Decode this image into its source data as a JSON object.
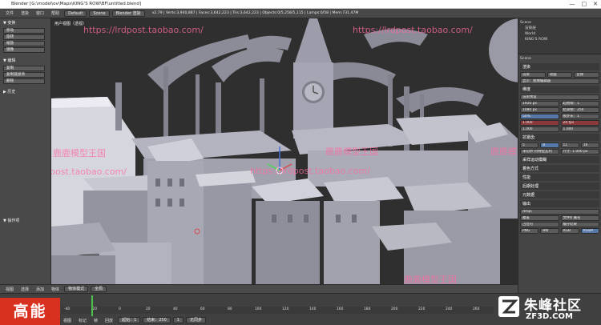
{
  "window": {
    "title": "Blender [G:\\model\\ov\\Maps\\KING'S ROW\\BF\\untitled.blend]",
    "controls": [
      "—",
      "□",
      "✕"
    ]
  },
  "infobar": {
    "menus": [
      "文件",
      "渲染",
      "窗口",
      "帮助"
    ],
    "layout": "Default",
    "scene": "Scene",
    "engine": "Blender 渲染",
    "stats": "v2.79 | Verts:3,940,887 | Faces:3,642,223 | Tris:3,642,223 | Objects:0/5,258/5,115 | Lamps:0/58 | Mem:731.47M"
  },
  "left_panel": {
    "transform_header": "▼ 变换",
    "transform_buttons": [
      "移动",
      "旋转",
      "缩放",
      "镜像"
    ],
    "edit_header": "▼ 编辑",
    "edit_buttons": [
      "复制",
      "复制链接项",
      "删除"
    ],
    "history_header": "▶ 历史",
    "operator_header": "▼ 操作项"
  },
  "viewport": {
    "header": "用户视图（透视）",
    "label": "(1) Collection | KING'S ROW"
  },
  "watermarks": [
    "https://lrdpost.taobao.com/",
    "https://lrdpost.taobao.com/",
    "https://lrdpost.taobao.com/",
    "鹿鹿模型王国",
    "鹿鹿模型王国",
    "鹿鹿模型王国",
    "鹿鹿模型王国",
    "post.taobao.com/"
  ],
  "view_footer": {
    "items": [
      "视图",
      "选择",
      "添加",
      "物体",
      "物体模式",
      "全局"
    ]
  },
  "outliner": {
    "items": [
      "Scene",
      "渲染层",
      "World",
      "KING'S ROW"
    ]
  },
  "properties": {
    "scene_label": "Scene",
    "sections": [
      "渲染",
      "维度",
      "抗锯齿",
      "采样运动模糊",
      "着色方式",
      "性能",
      "后期处理",
      "元数据",
      "输出"
    ],
    "render_buttons": [
      "渲染",
      "动画",
      "音频"
    ],
    "display": "显示：图像编辑器",
    "preset": "渲染预设",
    "resolution_x": "1920 px",
    "resolution_y": "1080 px",
    "resolution_pct": "50%",
    "frame_start": "起始帧：1",
    "frame_end": "结束帧：250",
    "frame_step": "帧步长：1",
    "aspect_x": "1.000",
    "aspect_y": "1.000",
    "fps": "24 fps",
    "time_stretch": "1.000",
    "aa_samples": [
      "5",
      "8",
      "11",
      "16"
    ],
    "filter": "米切尔-内特拉瓦利",
    "filter_size": "尺寸: 1.000 px",
    "output_path": "/tmp\\",
    "overwrite": "覆盖",
    "placeholders": "占位符",
    "file_ext": "文件扩展名",
    "cache": "缓存结果",
    "format": "PNG",
    "color_modes": [
      "BW",
      "RGB",
      "RGBA"
    ]
  },
  "timeline": {
    "ticks": [
      "-40",
      "-20",
      "0",
      "20",
      "40",
      "60",
      "80",
      "100",
      "120",
      "140",
      "160",
      "180",
      "200",
      "220",
      "240",
      "260"
    ],
    "footer": [
      "视图",
      "标记",
      "帧",
      "回放",
      "起始：1",
      "结束：250",
      "1",
      "无同步"
    ]
  },
  "overlay": {
    "badge": "高能",
    "site_cn": "朱峰社区",
    "site_url": "ZF3D.COM"
  },
  "colors": {
    "accent_blue": "#5678a8",
    "playhead": "#4ec24e",
    "badge": "#d8311f",
    "watermark": "#ff69a0"
  }
}
